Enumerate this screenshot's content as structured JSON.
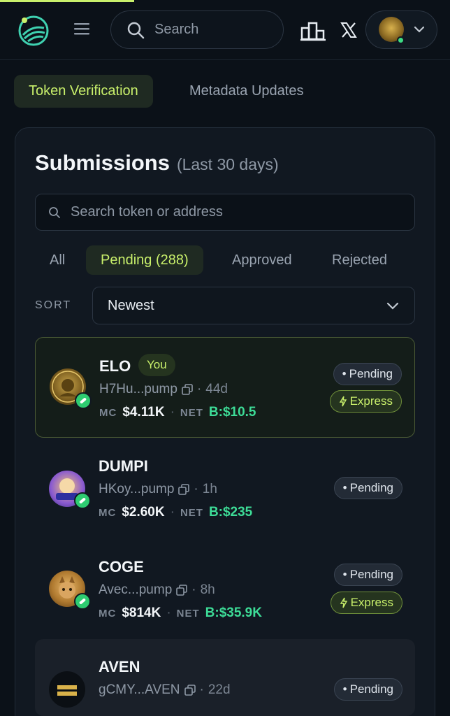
{
  "header": {
    "search_placeholder": "Search"
  },
  "top_tabs": [
    {
      "label": "Token Verification",
      "active": true
    },
    {
      "label": "Metadata Updates",
      "active": false
    }
  ],
  "submissions": {
    "title": "Submissions",
    "subtitle": "(Last 30 days)",
    "search_placeholder": "Search token or address",
    "filters": [
      {
        "label": "All",
        "active": false
      },
      {
        "label": "Pending (288)",
        "active": true
      },
      {
        "label": "Approved",
        "active": false
      },
      {
        "label": "Rejected",
        "active": false
      }
    ],
    "sort_label": "SORT",
    "sort_value": "Newest"
  },
  "tokens": [
    {
      "name": "ELO",
      "you": "You",
      "address": "H7Hu...pump",
      "age": "44d",
      "mc_label": "MC",
      "mc": "$4.11K",
      "net_label": "NET",
      "net": "B:$10.5",
      "status": "Pending",
      "express": "Express"
    },
    {
      "name": "DUMPI",
      "address": "HKoy...pump",
      "age": "1h",
      "mc_label": "MC",
      "mc": "$2.60K",
      "net_label": "NET",
      "net": "B:$235",
      "status": "Pending"
    },
    {
      "name": "COGE",
      "address": "Avec...pump",
      "age": "8h",
      "mc_label": "MC",
      "mc": "$814K",
      "net_label": "NET",
      "net": "B:$35.9K",
      "status": "Pending",
      "express": "Express"
    },
    {
      "name": "AVEN",
      "address": "gCMY...AVEN",
      "age": "22d",
      "status": "Pending"
    }
  ],
  "colors": {
    "background": "#0b1118",
    "accent": "#c9f06b",
    "net_green": "#3ddc97",
    "verified_green": "#2ecc71"
  }
}
